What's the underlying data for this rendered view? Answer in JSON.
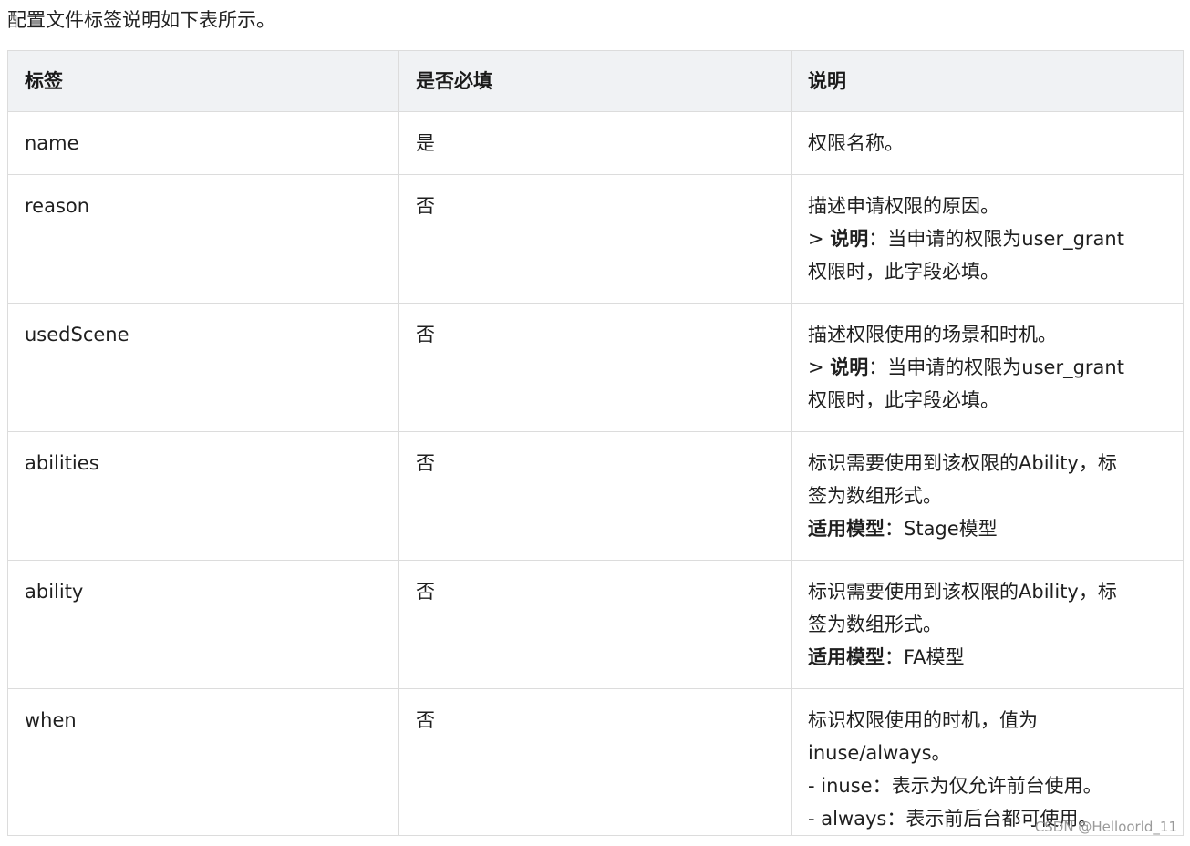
{
  "intro": "配置文件标签说明如下表所示。",
  "headers": [
    "标签",
    "是否必填",
    "说明"
  ],
  "rows": [
    {
      "tag": "name",
      "required": "是",
      "desc": {
        "line1": "权限名称。"
      }
    },
    {
      "tag": "reason",
      "required": "否",
      "desc": {
        "line1": "描述申请权限的原因。",
        "note_prefix": "> ",
        "note_label": "说明",
        "note_text": "：当申请的权限为user_grant",
        "note_cont": "权限时，此字段必填。"
      }
    },
    {
      "tag": "usedScene",
      "required": "否",
      "desc": {
        "line1": "描述权限使用的场景和时机。",
        "note_prefix": "> ",
        "note_label": "说明",
        "note_text": "：当申请的权限为user_grant",
        "note_cont": "权限时，此字段必填。"
      }
    },
    {
      "tag": "abilities",
      "required": "否",
      "desc": {
        "line1": "标识需要使用到该权限的Ability，标",
        "line2": "签为数组形式。",
        "model_label": "适用模型",
        "model_text": "：Stage模型"
      }
    },
    {
      "tag": "ability",
      "required": "否",
      "desc": {
        "line1": "标识需要使用到该权限的Ability，标",
        "line2": "签为数组形式。",
        "model_label": "适用模型",
        "model_text": "：FA模型"
      }
    },
    {
      "tag": "when",
      "required": "否",
      "desc": {
        "line1": "标识权限使用的时机，值为",
        "line2": "inuse/always。",
        "line3": "- inuse：表示为仅允许前台使用。",
        "line4": "- always：表示前后台都可使用。"
      }
    }
  ],
  "watermark": "CSDN @Helloorld_11"
}
